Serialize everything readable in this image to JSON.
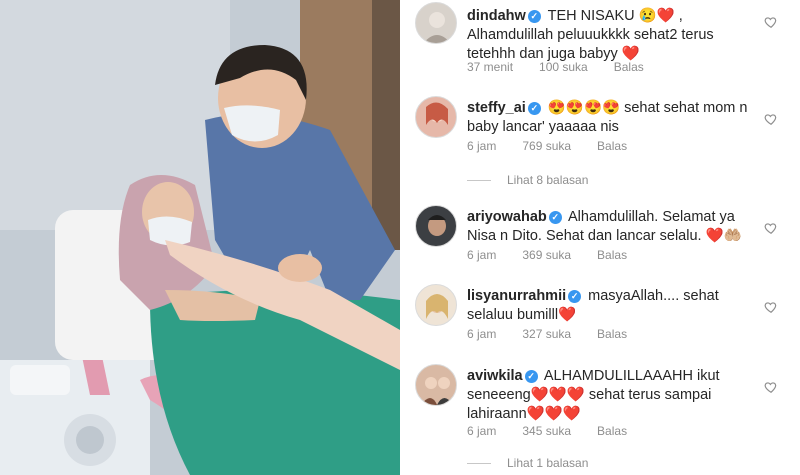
{
  "photo": {
    "alt": "",
    "watermark_part1": "",
    "watermark_part2": ""
  },
  "comments": [
    {
      "username": "dindahw",
      "verified": true,
      "text": "TEH NISAKU 😢❤️ , Alhamdulillah peluuukkkk sehat2 terus tetehhh dan juga babyy ❤️",
      "time": "37 menit",
      "likes": "100 suka",
      "reply": "Balas"
    },
    {
      "username": "steffy_ai",
      "verified": true,
      "text": "😍😍😍😍 sehat sehat mom n baby lancar' yaaaaa nis",
      "time": "6 jam",
      "likes": "769 suka",
      "reply": "Balas",
      "more_replies": "Lihat 8 balasan"
    },
    {
      "username": "ariyowahab",
      "verified": true,
      "text": "Alhamdulillah. Selamat ya Nisa n Dito. Sehat dan lancar selalu. ❤️🤲🏼",
      "time": "6 jam",
      "likes": "369 suka",
      "reply": "Balas"
    },
    {
      "username": "lisyanurrahmii",
      "verified": true,
      "text": "masyaAllah.... sehat selaluu bumilll❤️",
      "time": "6 jam",
      "likes": "327 suka",
      "reply": "Balas"
    },
    {
      "username": "aviwkila",
      "verified": true,
      "text": "ALHAMDULILLAAAHH ikut seneeeng❤️❤️❤️ sehat terus sampai lahiraann❤️❤️❤️",
      "time": "6 jam",
      "likes": "345 suka",
      "reply": "Balas",
      "more_replies": "Lihat 1 balasan"
    }
  ],
  "colors": {
    "verified": "#3897f0",
    "meta": "#8e8e8e",
    "text": "#262626"
  },
  "icons": {
    "like": "heart-outline-icon",
    "verified": "verified-badge-icon"
  }
}
